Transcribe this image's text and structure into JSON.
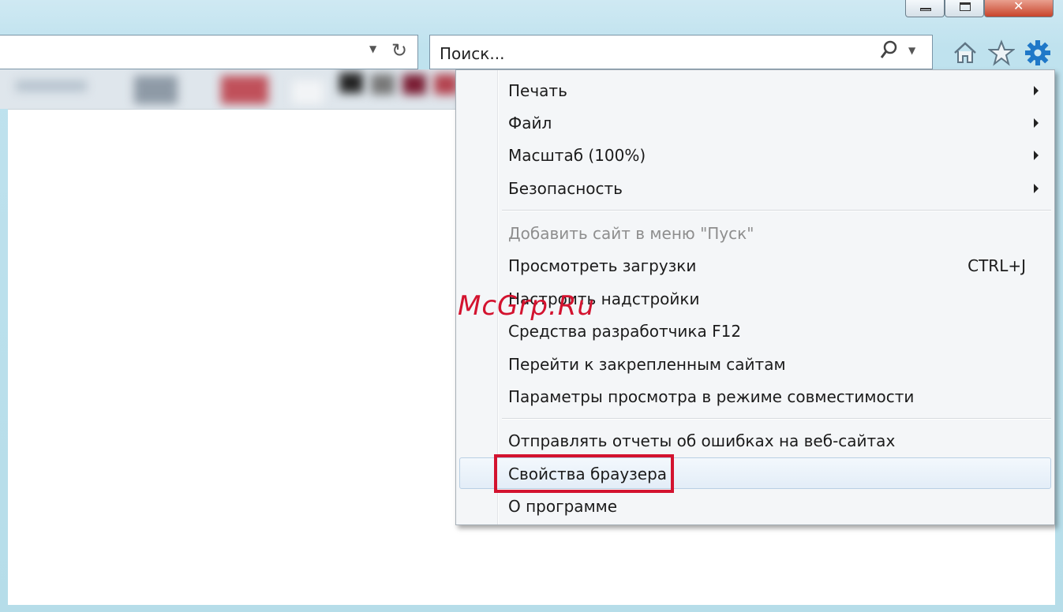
{
  "toolbar": {
    "search_placeholder": "Поиск..."
  },
  "menu": {
    "items": [
      {
        "label": "Печать",
        "submenu": true
      },
      {
        "label": "Файл",
        "submenu": true
      },
      {
        "label": "Масштаб (100%)",
        "submenu": true
      },
      {
        "label": "Безопасность",
        "submenu": true
      },
      {
        "label": "Добавить сайт в меню \"Пуск\"",
        "disabled": true
      },
      {
        "label": "Просмотреть загрузки",
        "shortcut": "CTRL+J"
      },
      {
        "label": "Настроить надстройки"
      },
      {
        "label": "Средства разработчика F12"
      },
      {
        "label": "Перейти к закрепленным сайтам"
      },
      {
        "label": "Параметры просмотра в режиме совместимости"
      },
      {
        "label": "Отправлять отчеты об ошибках на веб-сайтах"
      },
      {
        "label": "Свойства браузера",
        "highlighted": true
      },
      {
        "label": "О программе"
      }
    ]
  },
  "watermark": "McGrp.Ru",
  "colors": {
    "highlight": "#d3132f",
    "gear": "#1f78c8",
    "frame": "#a8dbe8"
  }
}
